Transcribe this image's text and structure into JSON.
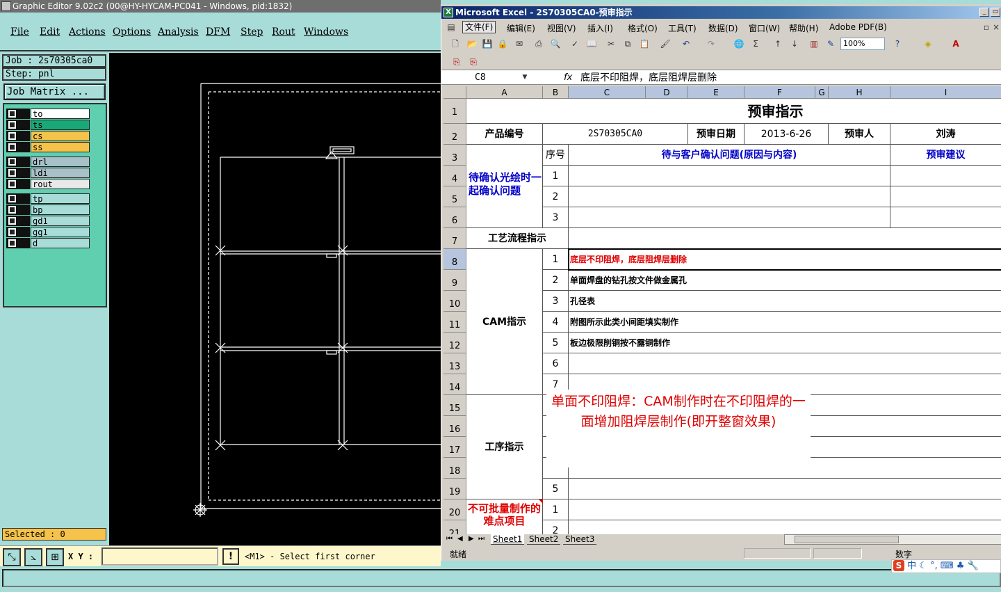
{
  "editor": {
    "title": "Graphic Editor 9.02c2 (00@HY-HYCAM-PC041 - Windows, pid:1832)",
    "menu": [
      "File",
      "Edit",
      "Actions",
      "Options",
      "Analysis",
      "DFM",
      "Step",
      "Rout",
      "Windows"
    ],
    "job_label": "Job : 2s70305ca0",
    "step_label": "Step: pnl",
    "job_matrix_button": "Job Matrix ...",
    "layers": [
      {
        "name": "to",
        "color": "#ffffff"
      },
      {
        "name": "ts",
        "color": "#1aa878"
      },
      {
        "name": "cs",
        "color": "#f5c34a"
      },
      {
        "name": "ss",
        "color": "#f5c34a"
      },
      {
        "name": "drl",
        "color": "#a8c0c8"
      },
      {
        "name": "ldi",
        "color": "#a8c0c8"
      },
      {
        "name": "rout",
        "color": "#e8e8e8"
      },
      {
        "name": "tp",
        "color": "#a8dcd8"
      },
      {
        "name": "bp",
        "color": "#a8dcd8"
      },
      {
        "name": "gd1",
        "color": "#a8dcd8"
      },
      {
        "name": "gg1",
        "color": "#a8dcd8"
      },
      {
        "name": "d",
        "color": "#a8dcd8"
      }
    ],
    "selected": "Selected : 0",
    "xy_label": "X Y :",
    "xy_value": "",
    "bang": "!",
    "status_message": "<M1> - Select first corner"
  },
  "excel": {
    "title": "Microsoft Excel - 2S70305CA0-预审指示",
    "menu": [
      "文件(F)",
      "编辑(E)",
      "视图(V)",
      "插入(I)",
      "格式(O)",
      "工具(T)",
      "数据(D)",
      "窗口(W)",
      "帮助(H)",
      "Adobe PDF(B)"
    ],
    "zoom": "100%",
    "name_box": "C8",
    "fx": "fx",
    "formula": "底层不印阻焊，底层阻焊层删除",
    "columns": [
      "A",
      "B",
      "C",
      "D",
      "E",
      "F",
      "G",
      "H",
      "I"
    ],
    "rows": [
      "1",
      "2",
      "3",
      "4",
      "5",
      "6",
      "7",
      "8",
      "9",
      "10",
      "11",
      "12",
      "13",
      "14",
      "15",
      "16",
      "17",
      "18",
      "19",
      "20",
      "21"
    ],
    "sheet": {
      "title": "预审指示",
      "product_no_label": "产品编号",
      "product_no": "2S70305CA0",
      "date_label": "预审日期",
      "date": "2013-6-26",
      "reviewer_label": "预审人",
      "reviewer": "刘涛",
      "seq_label": "序号",
      "issues_header": "待与客户确认问题(原因与内容)",
      "suggest_header": "预审建议",
      "confirm_label": "待确认光绘时一起确认问题",
      "confirm_seq": [
        "1",
        "2",
        "3"
      ],
      "process_label": "工艺流程指示",
      "cam_label": "CAM指示",
      "cam_seq": [
        "1",
        "2",
        "3",
        "4",
        "5",
        "6",
        "7"
      ],
      "cam_items": [
        "底层不印阻焊，底层阻焊层删除",
        "单面焊盘的钻孔按文件做金属孔",
        "孔径表",
        "附图所示此类小间距填实制作",
        "板边极限削铜按不露铜制作",
        "",
        ""
      ],
      "procedure_label": "工序指示",
      "procedure_seq_partial": "-",
      "procedure_seq_5": "5",
      "difficult_label": "不可批量制作的难点项目",
      "difficult_seq": [
        "1",
        "2"
      ]
    },
    "comment": "单面不印阻焊：CAM制作时在不印阻焊的一面增加阻焊层制作(即开整窗效果)",
    "sheets": [
      "Sheet1",
      "Sheet2",
      "Sheet3"
    ],
    "status_ready": "就绪",
    "status_mode": "数字"
  },
  "ime": {
    "label": "中",
    "logo": "S"
  }
}
